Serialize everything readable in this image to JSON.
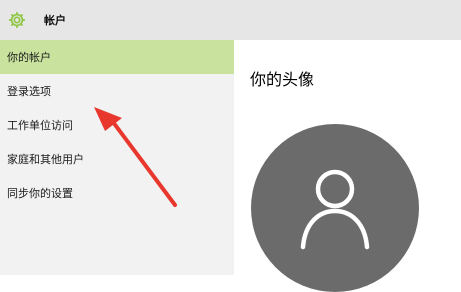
{
  "window": {
    "title": "帐户",
    "icon": "gear-icon"
  },
  "sidebar": {
    "items": [
      {
        "label": "你的帐户",
        "active": true
      },
      {
        "label": "登录选项",
        "active": false
      },
      {
        "label": "工作单位访问",
        "active": false
      },
      {
        "label": "家庭和其他用户",
        "active": false
      },
      {
        "label": "同步你的设置",
        "active": false
      }
    ]
  },
  "main": {
    "heading": "你的头像",
    "avatar_icon": "user-silhouette-icon"
  },
  "colors": {
    "accent_green": "#8cc63f",
    "active_item_bg": "#c9e39f",
    "avatar_bg": "#6b6b6b",
    "annotation_arrow": "#e8382e"
  }
}
